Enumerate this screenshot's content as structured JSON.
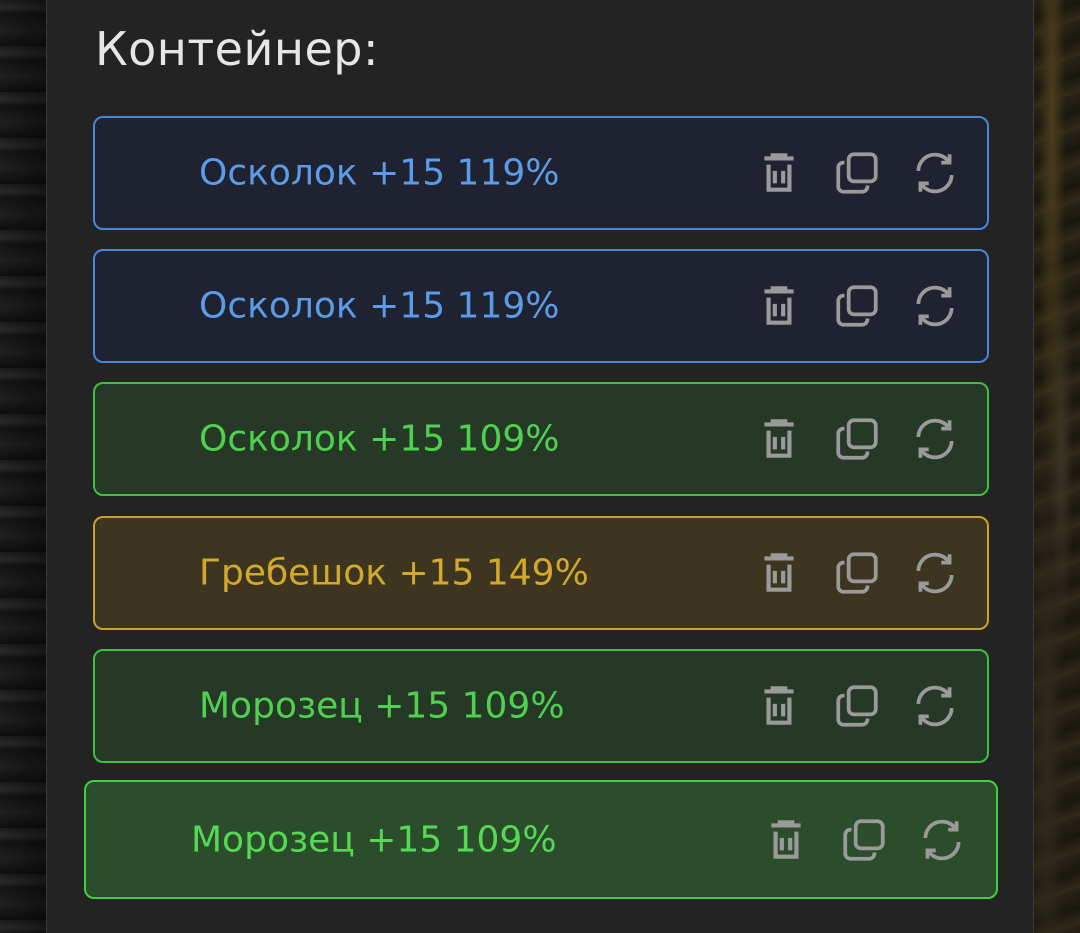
{
  "container": {
    "title": "Контейнер:"
  },
  "items": [
    {
      "label": "Осколок +15 119%",
      "style": "blue"
    },
    {
      "label": "Осколок +15 119%",
      "style": "blue"
    },
    {
      "label": "Осколок +15 109%",
      "style": "green"
    },
    {
      "label": "Гребешок +15 149%",
      "style": "gold"
    },
    {
      "label": "Морозец +15 109%",
      "style": "green"
    },
    {
      "label": "Морозец +15 109%",
      "style": "green-highlighted"
    }
  ],
  "icons": {
    "delete": "trash-icon",
    "copy": "copy-icon",
    "replace": "refresh-icon",
    "color": "#9a9a9a"
  },
  "colors": {
    "blue_border": "#4a86d6",
    "blue_text": "#5b9be8",
    "green_border": "#3fbf3f",
    "green_text": "#4fd14f",
    "gold_border": "#c9a227",
    "gold_text": "#d4a82a",
    "panel_bg": "#232323"
  }
}
